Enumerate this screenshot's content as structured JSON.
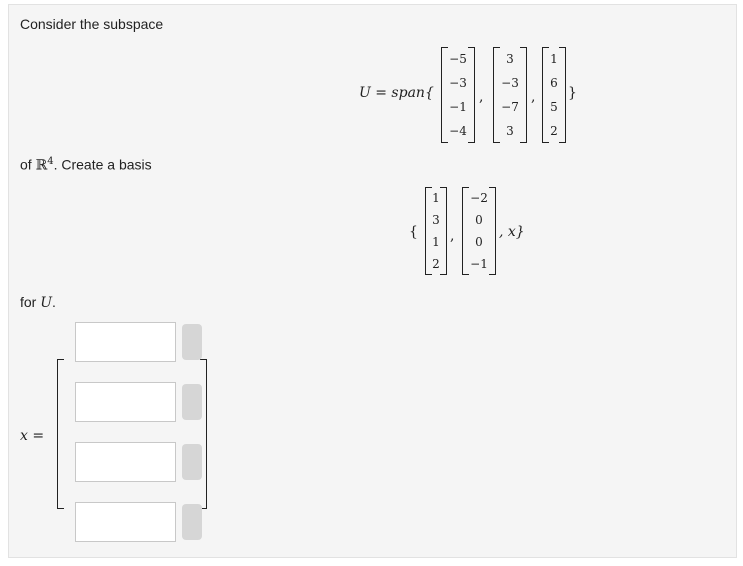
{
  "question": {
    "intro": "Consider the subspace",
    "U_equals_span": "U = span{",
    "span_close": "}",
    "of_prefix": "of ",
    "R_symbol": "ℝ",
    "R_exponent": "4",
    "create_text": ". Create a basis",
    "for_prefix": "for ",
    "for_var": "U",
    "for_suffix": ".",
    "x_equals": "x ="
  },
  "span_vectors": [
    [
      "−5",
      "−3",
      "−1",
      "−4"
    ],
    [
      "3",
      "−3",
      "−7",
      "3"
    ],
    [
      "1",
      "6",
      "5",
      "2"
    ]
  ],
  "basis": {
    "open": "{",
    "x_close": ", x}",
    "vectors": [
      [
        "1",
        "3",
        "1",
        "2"
      ],
      [
        "−2",
        "0",
        "0",
        "−1"
      ]
    ]
  },
  "separator": ",",
  "inputs": [
    {
      "value": "",
      "placeholder": ""
    },
    {
      "value": "",
      "placeholder": ""
    },
    {
      "value": "",
      "placeholder": ""
    },
    {
      "value": "",
      "placeholder": ""
    }
  ]
}
